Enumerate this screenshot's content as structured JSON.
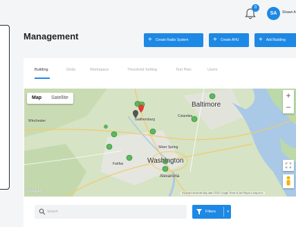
{
  "header": {
    "notification_count": "0",
    "avatar_initials": "SA",
    "user_name": "Shawn A"
  },
  "page": {
    "title": "Management"
  },
  "actions": {
    "create_radio": "Create Radio System",
    "create_ahu": "Create AHU",
    "add_building": "Add Building",
    "plus": "+"
  },
  "tabs": [
    {
      "label": "Building",
      "active": true
    },
    {
      "label": "Grids",
      "active": false
    },
    {
      "label": "Workspace",
      "active": false
    },
    {
      "label": "Threshold Setting",
      "active": false
    },
    {
      "label": "Test Plan",
      "active": false
    },
    {
      "label": "Users",
      "active": false
    }
  ],
  "map": {
    "type_map": "Map",
    "type_satellite": "Satellite",
    "zoom_in": "+",
    "zoom_out": "−",
    "attribution": "Keyboard shortcuts   Map data ©2022 Google   Terms of Use   Report a map error",
    "logo": "Google",
    "cities": {
      "baltimore": "Baltimore",
      "washington": "Washington",
      "alexandria": "Alexandria",
      "columbia": "Columbia",
      "gaithersburg": "Gaithersburg",
      "silver_spring": "Silver Spring",
      "fairfax": "Fairfax",
      "winchester": "Winchester"
    },
    "colors": {
      "marker_green": "#5cb85c",
      "marker_red": "#e53935",
      "marker_dark": "#555555",
      "water": "#a9c9e6"
    }
  },
  "search": {
    "placeholder": "Search"
  },
  "filters": {
    "label": "Filters",
    "chevron": "▾"
  },
  "colors": {
    "accent": "#1e88e5"
  }
}
